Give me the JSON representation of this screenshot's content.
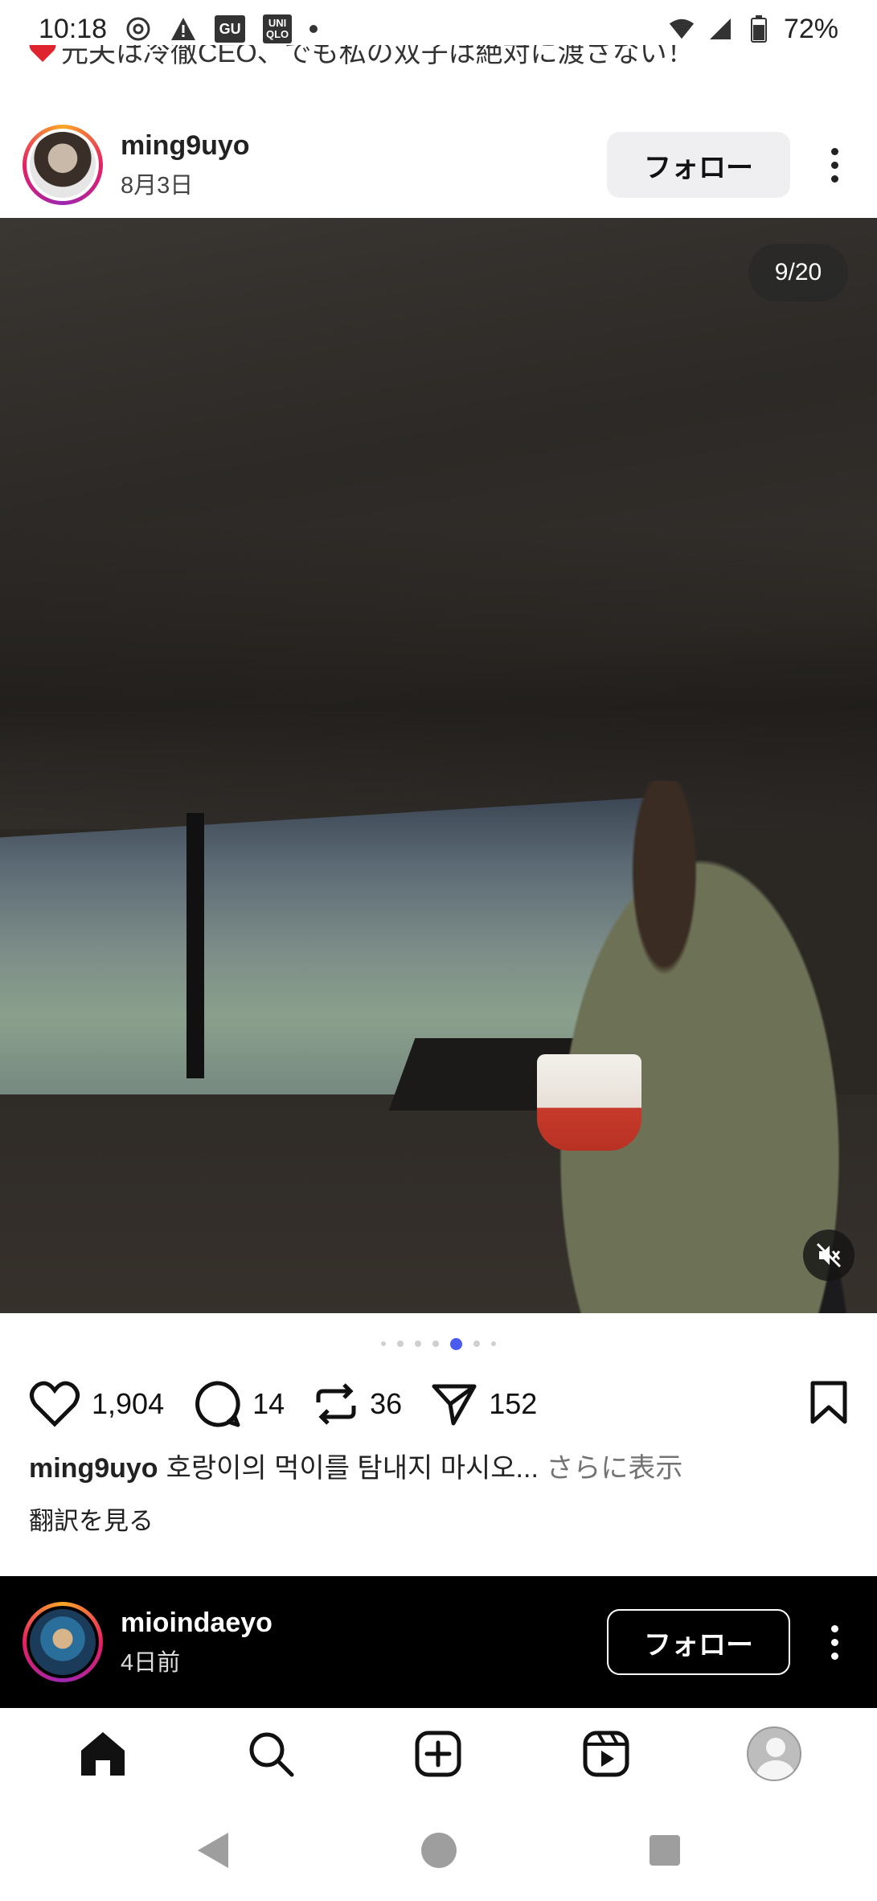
{
  "status_bar": {
    "time": "10:18",
    "notification_icons": [
      "threads-icon",
      "warning-icon",
      "gu-icon",
      "uniqlo-icon"
    ],
    "gu_label": "GU",
    "uniqlo_label_top": "UNI",
    "uniqlo_label_bottom": "QLO",
    "battery": "72%"
  },
  "previous_post": {
    "caption_partial": "元夫は冷徹CEO、でも私の双子は絶対に渡さない！"
  },
  "post": {
    "username": "ming9uyo",
    "date": "8月3日",
    "follow_label": "フォロー",
    "counter": "9/20",
    "likes": "1,904",
    "comments": "14",
    "reposts": "36",
    "shares": "152",
    "caption_user": "ming9uyo",
    "caption_text": "호랑이의 먹이를 탐내지 마시오...",
    "caption_more": "さらに表示",
    "translate_label": "翻訳を見る"
  },
  "next_post": {
    "username": "mioindaeyo",
    "date": "4日前",
    "follow_label": "フォロー"
  },
  "colors": {
    "accent_dot": "#4a5cf0",
    "follow_bg": "#efeff2",
    "next_post_bg": "#000000"
  }
}
